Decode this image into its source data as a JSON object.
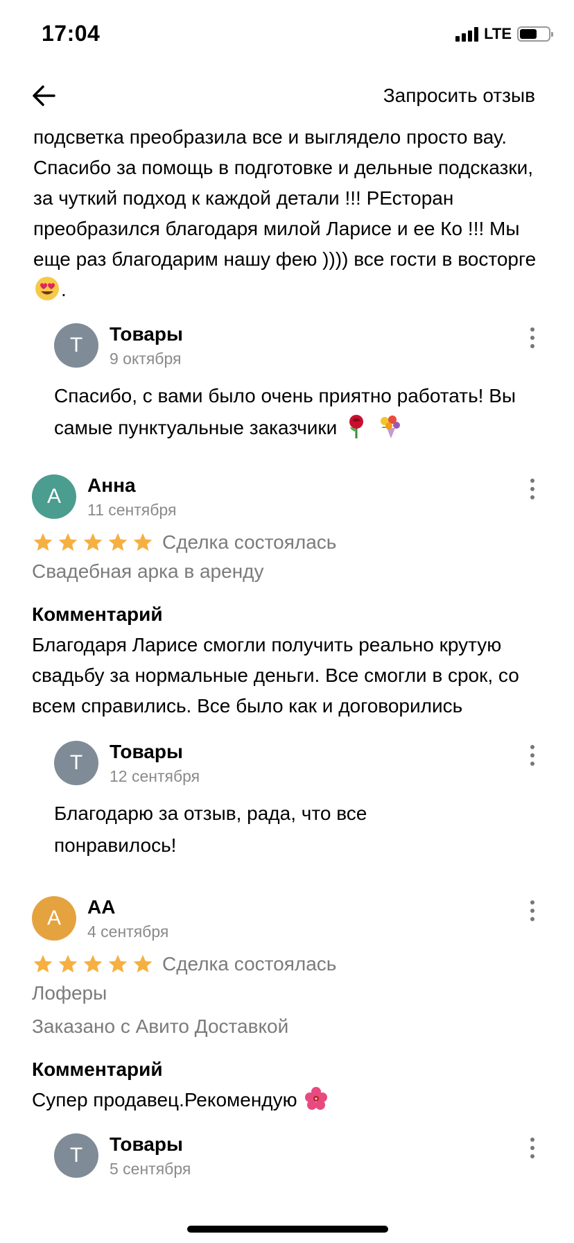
{
  "status_bar": {
    "time": "17:04",
    "network": "LTE"
  },
  "nav": {
    "request_review": "Запросить отзыв"
  },
  "top_review": {
    "text_part": "подсветка преобразила все и выглядело просто вау. Спасибо за помощь в подготовке и дельные подсказки, за чуткий подход к каждой детали !!! РЕсторан преобразился благодаря милой Ларисе и ее Ко !!! Мы еще раз благодарим нашу фею )))) все гости в восторге",
    "text_end": ".",
    "emoji": "heart-eyes-emoji",
    "reply": {
      "avatar_letter": "Т",
      "avatar_color": "#7f8c97",
      "name": "Товары",
      "date": "9 октября",
      "text": "Спасибо, с вами было очень приятно работать! Вы самые пунктуальные заказчики",
      "emojis": [
        "rose-emoji",
        "bouquet-emoji"
      ]
    }
  },
  "reviews": [
    {
      "avatar_letter": "А",
      "avatar_color": "#4a9d8f",
      "name": "Анна",
      "date": "11 сентября",
      "rating": 5,
      "deal_status": "Сделка состоялась",
      "item": "Свадебная арка в аренду",
      "comment_label": "Комментарий",
      "comment": "Благодаря Ларисе смогли получить реально крутую свадьбу за нормальные деньги. Все смогли в срок, со всем справились. Все было как и договорились",
      "reply": {
        "avatar_letter": "Т",
        "avatar_color": "#7f8c97",
        "name": "Товары",
        "date": "12 сентября",
        "text": "Благодарю за отзыв, рада, что все понравилось!"
      }
    },
    {
      "avatar_letter": "А",
      "avatar_color": "#e5a340",
      "name": "АА",
      "date": "4 сентября",
      "rating": 5,
      "deal_status": "Сделка состоялась",
      "item": "Лоферы",
      "delivery": "Заказано с Авито Доставкой",
      "comment_label": "Комментарий",
      "comment": "Супер продавец.Рекомендую",
      "comment_emoji": "hibiscus-emoji",
      "reply": {
        "avatar_letter": "Т",
        "avatar_color": "#7f8c97",
        "name": "Товары",
        "date": "5 сентября"
      }
    }
  ],
  "colors": {
    "star": "#f5b041",
    "muted_text": "#7b7b7b"
  }
}
